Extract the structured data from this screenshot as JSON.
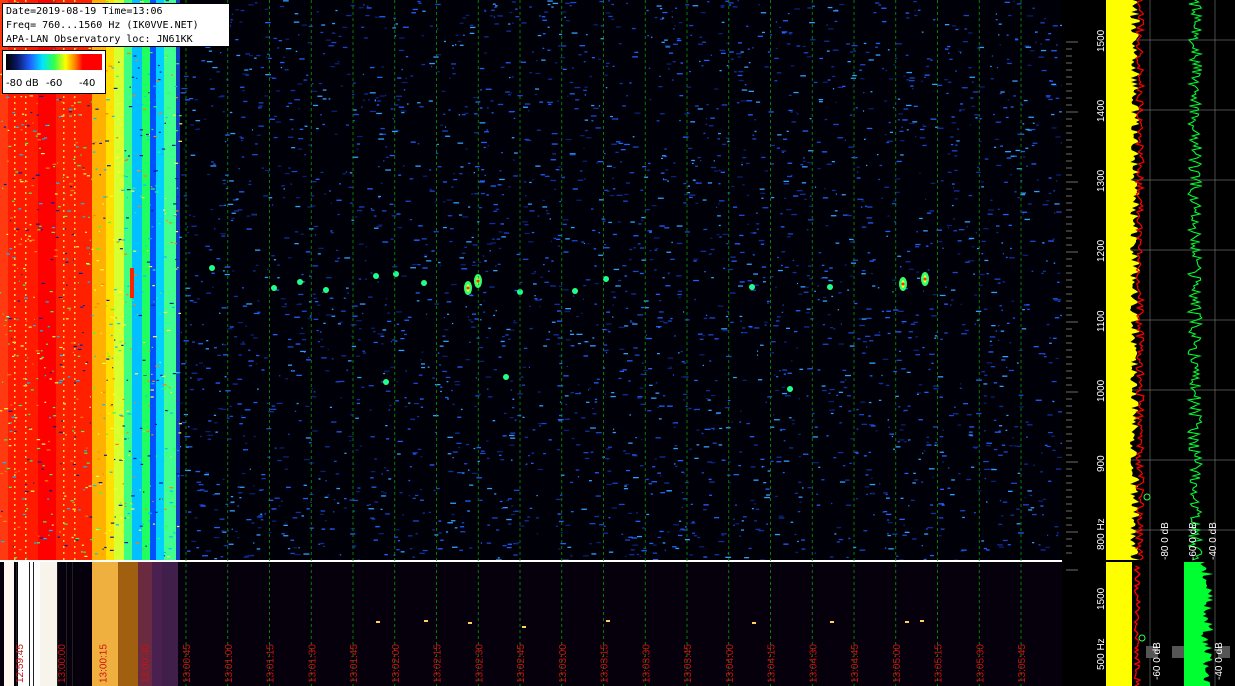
{
  "header": {
    "line1": "Date=2019-08-19 Time=13:06",
    "line2": "Freq= 760...1560 Hz (IK0VVE.NET)",
    "line3": "APA-LAN Observatory loc: JN61KK"
  },
  "scale": {
    "label_min": "-80 dB",
    "label_mid": "-60",
    "label_max": "-40"
  },
  "freq_axis": {
    "ticks": [
      "1500",
      "1400",
      "1300",
      "1200",
      "1100",
      "1000",
      "900",
      "800 Hz"
    ],
    "values": [
      1500,
      1400,
      1300,
      1200,
      1100,
      1000,
      900,
      800
    ]
  },
  "lower_freq_axis": {
    "ticks": [
      "1500",
      "500 Hz"
    ]
  },
  "time_axis": {
    "ticks": [
      "12:59:45",
      "13:00:00",
      "13:00:15",
      "13:00:30",
      "13:00:45",
      "13:01:00",
      "13:01:15",
      "13:01:30",
      "13:01:45",
      "13:02:00",
      "13:02:15",
      "13:02:30",
      "13:02:45",
      "13:03:00",
      "13:03:15",
      "13:03:30",
      "13:03:45",
      "13:04:00",
      "13:04:15",
      "13:04:30",
      "13:04:45",
      "13:05:00",
      "13:05:15",
      "13:05:30",
      "13:05:45"
    ]
  },
  "spectrum_panel": {
    "labels": [
      "-80 0 dB",
      "-60 0 dB",
      "-40 0 dB",
      "-60 0 dB",
      "-40 0 dB"
    ]
  },
  "colors": {
    "background": "#000000",
    "grid": "#00a000",
    "time_label": "#d01010",
    "spectrum_yellow": "#ffff00",
    "spectrum_red": "#ff0000",
    "spectrum_green": "#00ff30"
  }
}
